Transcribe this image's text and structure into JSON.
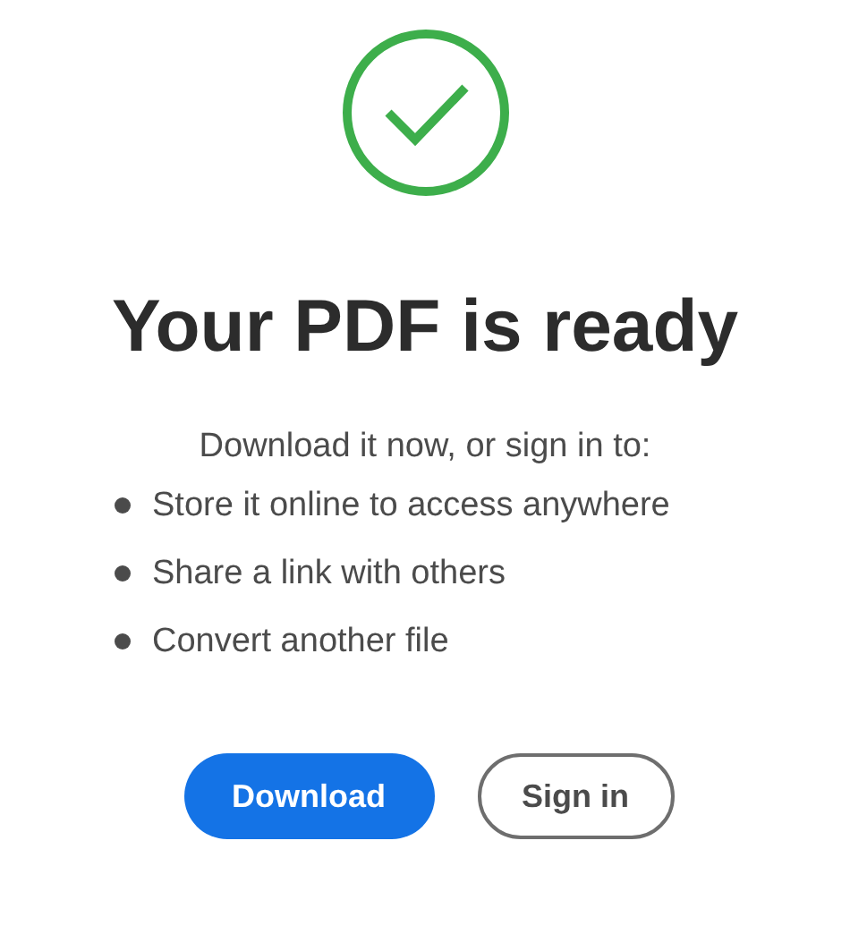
{
  "title": "Your PDF is ready",
  "intro": "Download it now, or sign in to:",
  "benefits": [
    "Store it online to access anywhere",
    "Share a link with others",
    "Convert another file"
  ],
  "buttons": [
    {
      "label": "Download",
      "kind": "primary"
    },
    {
      "label": "Sign in",
      "kind": "secondary"
    }
  ]
}
